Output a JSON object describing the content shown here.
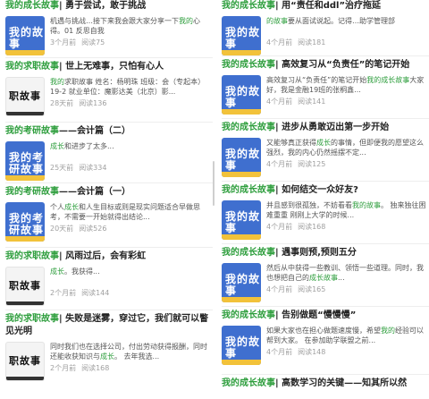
{
  "left": [
    {
      "tag": "我的成长故事",
      "rest": "| 勇于尝试，敢于挑战",
      "desc_pre": "机遇与挑战…接下来我会跟大家分享一下",
      "desc_hl": "我的",
      "desc_post": "心得。01 反思自我",
      "time": "3个月前",
      "reads": "阅读75",
      "thumb": "我的故事",
      "thumb_style": "blue"
    },
    {
      "tag": "我的求职故事",
      "rest": "| 世上无难事，只怕有心人",
      "desc_pre": "",
      "desc_hl": "我的",
      "desc_post": "求职故事 姓名：杨明珠 班级：会（专起本）19-2 就业单位：魔影达美（北京）影...",
      "time": "28天前",
      "reads": "阅读136",
      "thumb": "职故事",
      "thumb_style": "white"
    },
    {
      "tag": "我的考研故事",
      "rest": "——会计篇（二）",
      "desc_pre": "",
      "desc_hl": "成长",
      "desc_post": "和进步了太多...",
      "time": "25天前",
      "reads": "阅读334",
      "thumb": "我的考研故事",
      "thumb_style": "blue"
    },
    {
      "tag": "我的考研故事",
      "rest": "——会计篇（一）",
      "desc_pre": "个人",
      "desc_hl": "成长",
      "desc_post": "和人生目标或则是现实问题适合早做思考，不需要一开始就得出结论...",
      "time": "20天前",
      "reads": "阅读526",
      "thumb": "我的考研故事",
      "thumb_style": "blue"
    },
    {
      "tag": "我的求职故事",
      "rest": "| 风雨过后，会有彩虹",
      "desc_pre": "",
      "desc_hl": "成长",
      "desc_post": "。我获得...",
      "time": "2个月前",
      "reads": "阅读144",
      "thumb": "职故事",
      "thumb_style": "white"
    },
    {
      "tag": "我的求职故事",
      "rest": "| 失败是迷雾，穿过它，我们就可以瞥见光明",
      "desc_pre": "同时我们也在选择公司，付出劳动获得报酬，同时还能收获知识与",
      "desc_hl": "成长",
      "desc_post": "。 去年我选...",
      "time": "2个月前",
      "reads": "阅读168",
      "thumb": "职故事",
      "thumb_style": "white"
    }
  ],
  "right": [
    {
      "tag": "我的成长故事",
      "rest": "| 用“责任和ddl”治疗拖延",
      "desc_pre": "",
      "desc_hl": "的故事",
      "desc_post": "要从面试说起。记得…助学管理部",
      "time": "4个月前",
      "reads": "阅读181",
      "thumb": "我的故事",
      "thumb_style": "blue"
    },
    {
      "tag": "我的成长故事",
      "rest": "| 高效复习从“负责任”的笔记开始",
      "desc_pre": "高效复习从“负责任”的笔记开始",
      "desc_hl": "我的成长故事",
      "desc_post": "大家好，我是金融19班的张桐鑫...",
      "time": "4个月前",
      "reads": "阅读141",
      "thumb": "我的故事",
      "thumb_style": "blue"
    },
    {
      "tag": "我的成长故事",
      "rest": "| 进步从勇敢迈出第一步开始",
      "desc_pre": "又能够真正获得",
      "desc_hl": "成长",
      "desc_post": "的事情，但即便我的愿望这么强烈，我的内心仍然摇摆不定...",
      "time": "4个月前",
      "reads": "阅读125",
      "thumb": "我的故事",
      "thumb_style": "blue"
    },
    {
      "tag": "我的成长故事",
      "rest": "| 如何结交一众好友?",
      "desc_pre": "并且感到很孤独，不妨看看",
      "desc_hl": "我的故事",
      "desc_post": "。 独来独往困难重重 刚刚上大学的时候...",
      "time": "4个月前",
      "reads": "阅读168",
      "thumb": "我的故事",
      "thumb_style": "blue"
    },
    {
      "tag": "我的成长故事",
      "rest": "| 遇事则预,预则五分",
      "desc_pre": "然后从中获得一些教训、领悟一些道理。同时，我也想把自己的",
      "desc_hl": "成长故事",
      "desc_post": "...",
      "time": "4个月前",
      "reads": "阅读165",
      "thumb": "我的故事",
      "thumb_style": "blue"
    },
    {
      "tag": "我的成长故事",
      "rest": "| 告别做题“慢慢慢”",
      "desc_pre": "如果大家也在担心做题速度慢，希望",
      "desc_hl": "我的",
      "desc_post": "经验可以帮到大家。 在参加助学联盟之前...",
      "time": "4个月前",
      "reads": "阅读148",
      "thumb": "我的故事",
      "thumb_style": "blue"
    },
    {
      "tag": "我的成长故事",
      "rest": "| 高数学习的关键——知其所以然",
      "desc_pre": "",
      "desc_hl": "",
      "desc_post": "",
      "time": "",
      "reads": "",
      "thumb": "",
      "thumb_style": "none"
    }
  ],
  "colors": {
    "accent": "#2e9e3d",
    "thumb_blue": "#3f6fcf",
    "meta": "#a0a0a0"
  }
}
